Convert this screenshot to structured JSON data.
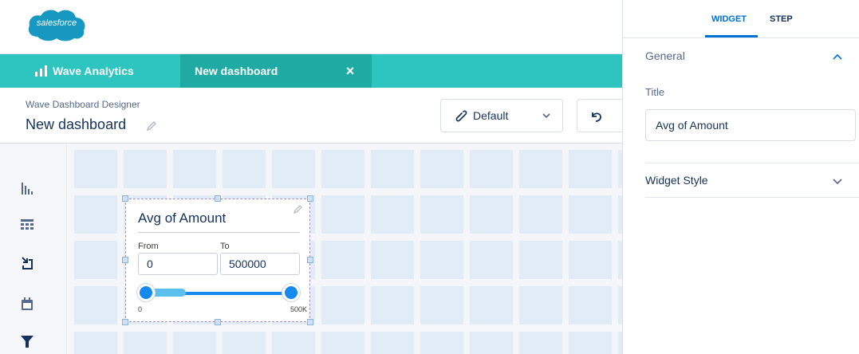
{
  "brand": {
    "logo_text": "salesforce",
    "accent": "#2ec4c0",
    "accent_dark": "#20aaa4",
    "link": "#0070d2"
  },
  "tabs": {
    "app_label": "Wave Analytics",
    "active_label": "New dashboard",
    "close_icon": "×"
  },
  "designer": {
    "subtitle": "Wave Dashboard Designer",
    "title": "New dashboard",
    "default_label": "Default"
  },
  "toolbox": {
    "items": [
      {
        "icon": "chart-icon"
      },
      {
        "icon": "table-icon"
      },
      {
        "icon": "compare-icon"
      },
      {
        "icon": "calendar-icon"
      },
      {
        "icon": "filter-icon"
      }
    ]
  },
  "widget": {
    "title": "Avg of Amount",
    "from_label": "From",
    "to_label": "To",
    "from_value": "0",
    "to_value": "500000",
    "range_min_label": "0",
    "range_max_label": "500K",
    "selected_range": [
      0,
      500000
    ]
  },
  "panel": {
    "tab_widget": "WIDGET",
    "tab_step": "STEP",
    "section_general": "General",
    "title_label": "Title",
    "title_value": "Avg of Amount",
    "section_style": "Widget Style"
  }
}
